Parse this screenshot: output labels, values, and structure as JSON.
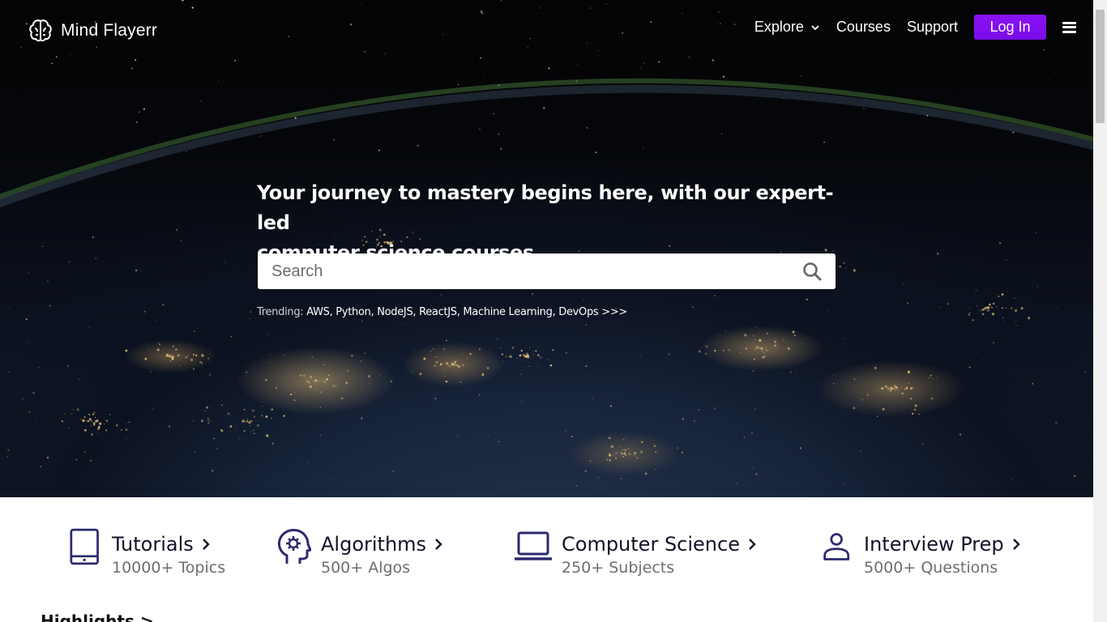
{
  "brand": {
    "name": "Mind Flayerr",
    "icon": "brain-icon"
  },
  "nav": {
    "explore": "Explore",
    "courses": "Courses",
    "support": "Support",
    "login": "Log In",
    "menu_icon": "hamburger-icon"
  },
  "hero": {
    "headline_line1": "Your journey to mastery begins here, with our expert-led",
    "headline_line2": "computer science courses.",
    "search_placeholder": "Search",
    "trending_label": "Trending:",
    "trending_items": "AWS, Python, NodeJS, ReactJS, Machine Learning, DevOps >>>"
  },
  "categories": [
    {
      "title": "Tutorials",
      "subtitle": "10000+ Topics",
      "icon": "tablet-icon"
    },
    {
      "title": "Algorithms",
      "subtitle": "500+ Algos",
      "icon": "head-gear-icon"
    },
    {
      "title": "Computer Science",
      "subtitle": "250+ Subjects",
      "icon": "laptop-icon"
    },
    {
      "title": "Interview Prep",
      "subtitle": "5000+ Questions",
      "icon": "user-icon"
    }
  ],
  "highlights_heading": "Highlights >",
  "colors": {
    "accent": "#7a0be8",
    "icon_navy": "#2b2a6e",
    "text_dark": "#12122a",
    "text_muted": "#6e6e6e"
  }
}
